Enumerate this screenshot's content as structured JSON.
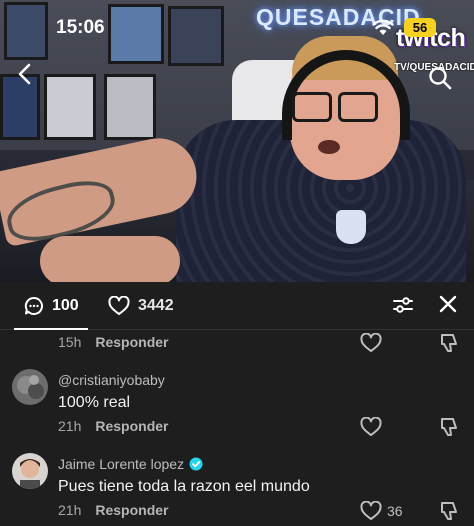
{
  "status_bar": {
    "time": "15:06",
    "battery": "56"
  },
  "video": {
    "neon_sign": "QUESADACID",
    "twitch_logo": "twitch",
    "twitch_handle": "TV/QUESADACID"
  },
  "comments_panel": {
    "comment_count": "100",
    "like_count": "3442",
    "reply_label": "Responder",
    "comments": [
      {
        "time": "15h",
        "reply": "Responder"
      },
      {
        "username": "@cristianiyobaby",
        "text": "100% real",
        "time": "21h",
        "reply": "Responder"
      },
      {
        "username": "Jaime Lorente lopez",
        "verified": true,
        "text": "Pues tiene toda la razon eel mundo",
        "time": "21h",
        "reply": "Responder",
        "likes": "36"
      }
    ]
  },
  "colors": {
    "panel_bg": "#1e1e1e",
    "battery": "#f6d21e",
    "verified": "#20d5ec",
    "text_secondary": "#a8a8a8"
  },
  "icons": [
    "back-icon",
    "search-icon",
    "wifi-icon",
    "comment-icon",
    "heart-icon",
    "filter-icon",
    "close-icon",
    "dislike-icon",
    "verified-icon"
  ]
}
